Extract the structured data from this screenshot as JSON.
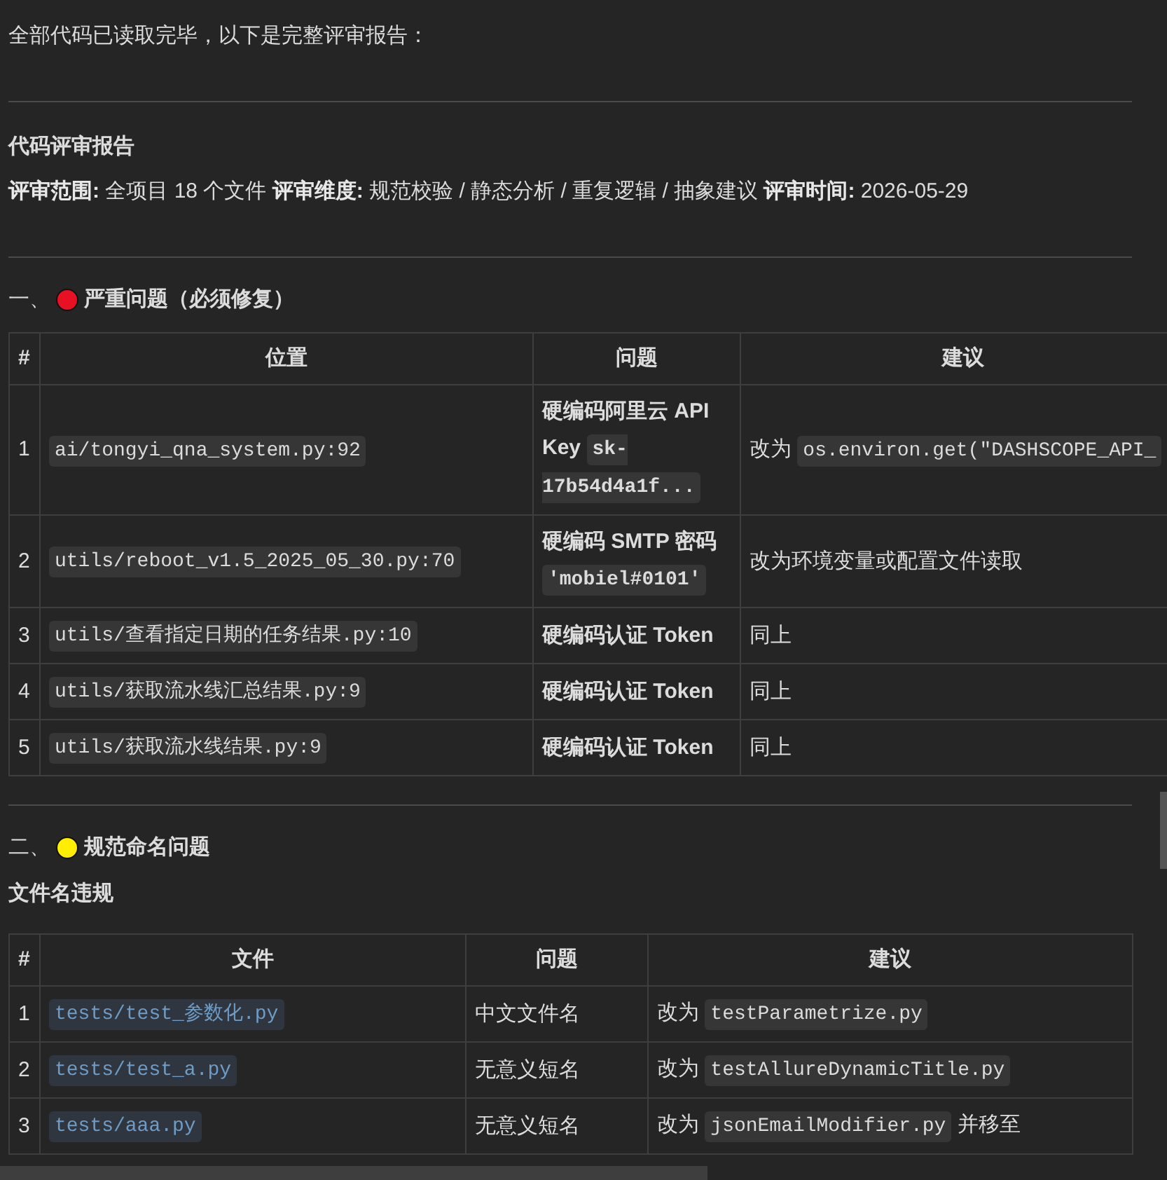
{
  "intro": "全部代码已读取完毕，以下是完整评审报告：",
  "report_title": "代码评审报告",
  "meta": "**评审范围:** 全项目 18 个文件 **评审维度:** 规范校验 / 静态分析 / 重复逻辑 / 抽象建议 **评审时间:** 2026-05-29",
  "sections": [
    {
      "number": "一、",
      "color": "#e81123",
      "title": "严重问题（必须修复）",
      "table": {
        "columns": [
          {
            "label": "#",
            "bold": false
          },
          {
            "label": "位置",
            "bold": false
          },
          {
            "label": "问题",
            "bold": true
          },
          {
            "label": "建议",
            "bold": false
          }
        ],
        "rows": [
          [
            [
              {
                "kind": "text",
                "text": "1"
              }
            ],
            [
              {
                "kind": "code",
                "text": "ai/tongyi_qna_system.py:92"
              }
            ],
            [
              {
                "kind": "text",
                "text": "硬编码阿里云 API Key "
              },
              {
                "kind": "code",
                "text": "sk-17b54d4a1f..."
              }
            ],
            [
              {
                "kind": "text",
                "text": "改为 "
              },
              {
                "kind": "code",
                "text": "os.environ.get(\"DASHSCOPE_API_"
              }
            ]
          ],
          [
            [
              {
                "kind": "text",
                "text": "2"
              }
            ],
            [
              {
                "kind": "code",
                "text": "utils/reboot_v1.5_2025_05_30.py:70"
              }
            ],
            [
              {
                "kind": "text",
                "text": "硬编码 SMTP 密码 "
              },
              {
                "kind": "code",
                "text": "'mobiel#0101'"
              }
            ],
            [
              {
                "kind": "text",
                "text": "改为环境变量或配置文件读取"
              }
            ]
          ],
          [
            [
              {
                "kind": "text",
                "text": "3"
              }
            ],
            [
              {
                "kind": "code",
                "text": "utils/查看指定日期的任务结果.py:10"
              }
            ],
            [
              {
                "kind": "text",
                "text": "硬编码认证 Token"
              }
            ],
            [
              {
                "kind": "text",
                "text": "同上"
              }
            ]
          ],
          [
            [
              {
                "kind": "text",
                "text": "4"
              }
            ],
            [
              {
                "kind": "code",
                "text": "utils/获取流水线汇总结果.py:9"
              }
            ],
            [
              {
                "kind": "text",
                "text": "硬编码认证 Token"
              }
            ],
            [
              {
                "kind": "text",
                "text": "同上"
              }
            ]
          ],
          [
            [
              {
                "kind": "text",
                "text": "5"
              }
            ],
            [
              {
                "kind": "code",
                "text": "utils/获取流水线结果.py:9"
              }
            ],
            [
              {
                "kind": "text",
                "text": "硬编码认证 Token"
              }
            ],
            [
              {
                "kind": "text",
                "text": "同上"
              }
            ]
          ]
        ]
      }
    },
    {
      "number": "二、",
      "color": "#ffee00",
      "title": "规范命名问题",
      "subtitle": "文件名违规",
      "table": {
        "columns": [
          {
            "label": "#",
            "bold": false
          },
          {
            "label": "文件",
            "bold": false
          },
          {
            "label": "问题",
            "bold": false
          },
          {
            "label": "建议",
            "bold": false
          }
        ],
        "rows": [
          [
            [
              {
                "kind": "text",
                "text": "1"
              }
            ],
            [
              {
                "kind": "link_code",
                "text": "tests/test_参数化.py"
              }
            ],
            [
              {
                "kind": "text",
                "text": "中文文件名"
              }
            ],
            [
              {
                "kind": "text",
                "text": "改为 "
              },
              {
                "kind": "code",
                "text": "testParametrize.py"
              }
            ]
          ],
          [
            [
              {
                "kind": "text",
                "text": "2"
              }
            ],
            [
              {
                "kind": "link_code",
                "text": "tests/test_a.py"
              }
            ],
            [
              {
                "kind": "text",
                "text": "无意义短名"
              }
            ],
            [
              {
                "kind": "text",
                "text": "改为 "
              },
              {
                "kind": "code",
                "text": "testAllureDynamicTitle.py"
              }
            ]
          ],
          [
            [
              {
                "kind": "text",
                "text": "3"
              }
            ],
            [
              {
                "kind": "link_code",
                "text": "tests/aaa.py"
              }
            ],
            [
              {
                "kind": "text",
                "text": "无意义短名"
              }
            ],
            [
              {
                "kind": "text",
                "text": "改为 "
              },
              {
                "kind": "code",
                "text": "jsonEmailModifier.py"
              },
              {
                "kind": "text",
                "text": " 并移至"
              }
            ]
          ]
        ]
      }
    }
  ]
}
